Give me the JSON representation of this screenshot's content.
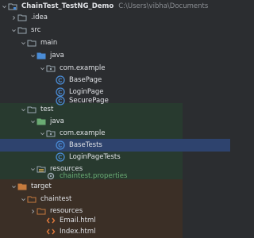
{
  "project": {
    "name": "ChainTest_TestNG_Demo",
    "path": "C:\\Users\\vibha\\Documents"
  },
  "tree": {
    "idea": ".idea",
    "src": "src",
    "main": "main",
    "main_java": "java",
    "main_pkg": "com.example",
    "base_page": "BasePage",
    "login_page": "LoginPage",
    "secure_page": "SecurePage",
    "test": "test",
    "test_java": "java",
    "test_pkg": "com.example",
    "base_tests": "BaseTests",
    "login_page_tests": "LoginPageTests",
    "resources": "resources",
    "chaintest_properties": "chaintest.properties",
    "target": "target",
    "chaintest": "chaintest",
    "target_resources": "resources",
    "email_html": "Email.html",
    "index_html": "Index.html"
  },
  "selected_item": "BaseTests",
  "colors": {
    "background": "#2b2d30",
    "test_region": "#283a2f",
    "target_region": "#3b2f26",
    "selection": "#2e436e",
    "folder": "#9aa7b0",
    "folder_source": "#4a8cd6",
    "folder_test": "#6aab73",
    "folder_resources": "#c8a046",
    "folder_excluded": "#c67a3d",
    "class_icon": "#4a8cd6",
    "test_text": "#6aab73",
    "html_icon": "#e07a3d"
  }
}
